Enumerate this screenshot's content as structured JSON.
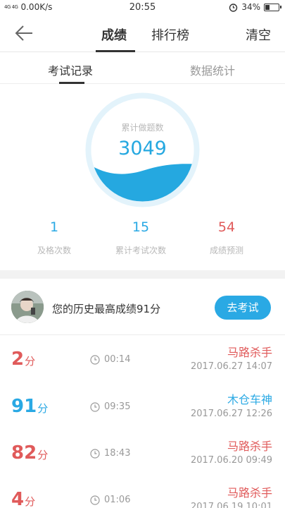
{
  "status_bar": {
    "signal": "4G 4G",
    "speed": "0.00K/s",
    "time": "20:55",
    "battery": "34%",
    "battery_level": 0.34
  },
  "header": {
    "tab_score": "成绩",
    "tab_rank": "排行榜",
    "clear": "清空"
  },
  "subtabs": {
    "records": "考试记录",
    "stats": "数据统计"
  },
  "gauge": {
    "label": "累计做题数",
    "value": "3049"
  },
  "stats": [
    {
      "value": "1",
      "label": "及格次数",
      "color": "#2aa9e4"
    },
    {
      "value": "15",
      "label": "累计考试次数",
      "color": "#2aa9e4"
    },
    {
      "value": "54",
      "label": "成绩预测",
      "color": "#e05a5a"
    }
  ],
  "best": {
    "text": "您的历史最高成绩91分",
    "button": "去考试"
  },
  "records": [
    {
      "score": "2",
      "unit": "分",
      "duration": "00:14",
      "title": "马路杀手",
      "date": "2017.06.27  14:07",
      "color": "#e05a5a"
    },
    {
      "score": "91",
      "unit": "分",
      "duration": "09:35",
      "title": "木仓车神",
      "date": "2017.06.27  12:26",
      "color": "#2aa9e4"
    },
    {
      "score": "82",
      "unit": "分",
      "duration": "18:43",
      "title": "马路杀手",
      "date": "2017.06.20  09:49",
      "color": "#e05a5a"
    },
    {
      "score": "4",
      "unit": "分",
      "duration": "01:06",
      "title": "马路杀手",
      "date": "2017.06.19  10:01",
      "color": "#e05a5a"
    }
  ],
  "colors": {
    "accent_blue": "#2aa9e4",
    "accent_red": "#e05a5a"
  }
}
